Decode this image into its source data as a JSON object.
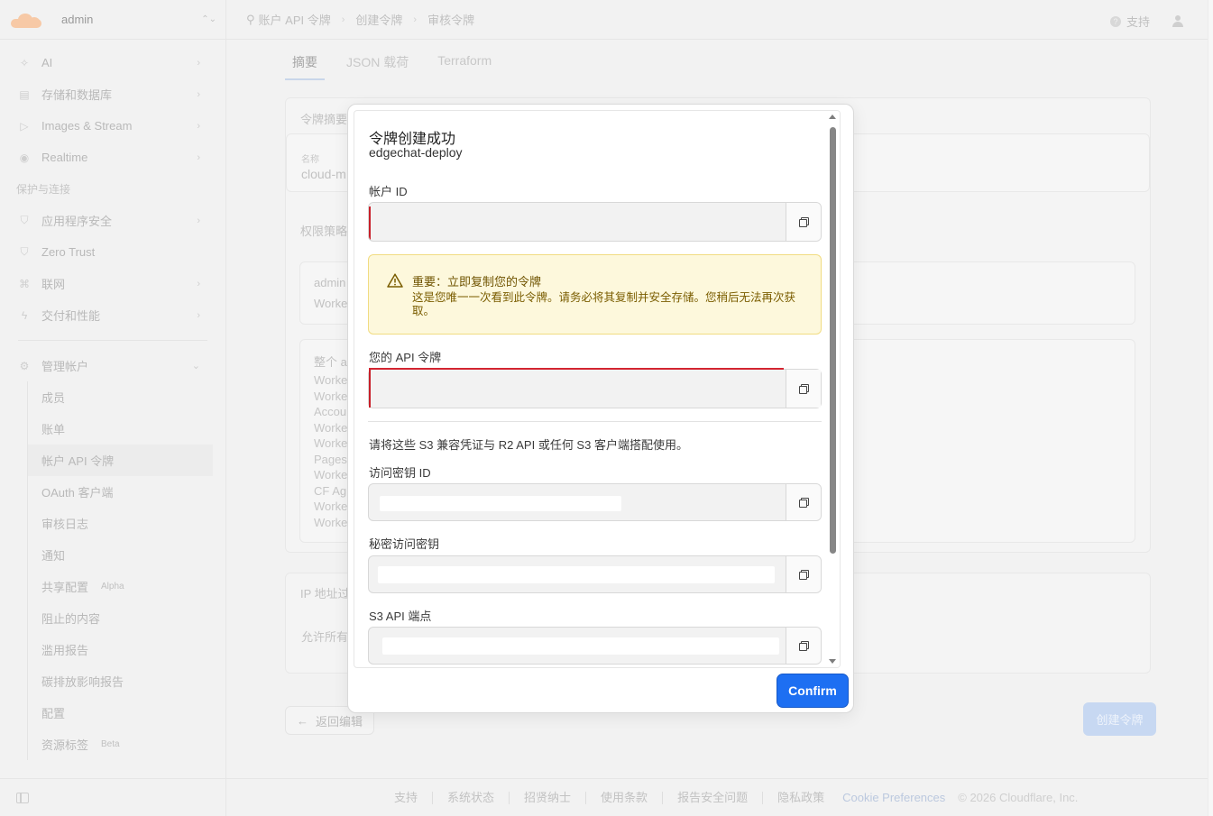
{
  "sidebar": {
    "account": "admin",
    "items": [
      {
        "label": "AI"
      },
      {
        "label": "存储和数据库"
      },
      {
        "label": "Images & Stream"
      },
      {
        "label": "Realtime"
      }
    ],
    "section": "保护与连接",
    "items2": [
      {
        "label": "应用程序安全"
      },
      {
        "label": "Zero Trust"
      },
      {
        "label": "联网"
      },
      {
        "label": "交付和性能"
      }
    ],
    "manage": "管理帐户",
    "sub_items": [
      {
        "label": "成员",
        "tag": ""
      },
      {
        "label": "账单",
        "tag": ""
      },
      {
        "label": "帐户 API 令牌",
        "tag": ""
      },
      {
        "label": "OAuth 客户端",
        "tag": ""
      },
      {
        "label": "审核日志",
        "tag": ""
      },
      {
        "label": "通知",
        "tag": ""
      },
      {
        "label": "共享配置",
        "tag": "Alpha"
      },
      {
        "label": "阻止的内容",
        "tag": ""
      },
      {
        "label": "滥用报告",
        "tag": ""
      },
      {
        "label": "碳排放影响报告",
        "tag": ""
      },
      {
        "label": "配置",
        "tag": ""
      },
      {
        "label": "资源标签",
        "tag": "Beta"
      }
    ]
  },
  "topbar": {
    "breadcrumb": [
      "账户 API 令牌",
      "创建令牌",
      "审核令牌"
    ],
    "support": "支持"
  },
  "main": {
    "tabs": [
      "摘要",
      "JSON 载荷",
      "Terraform"
    ],
    "summary_heading": "令牌摘要",
    "name_label": "名称",
    "name_value": "cloud-m",
    "policy_heading": "权限策略",
    "policy_title": "admin",
    "policy_sub": "Worke",
    "scope_title": "整个 a",
    "scope_list": [
      "Worke",
      "Worke",
      "Accou",
      "Worke",
      "Worke",
      "Pages",
      "Worke",
      "CF Ag",
      "Worke",
      "Worke"
    ],
    "ip_heading": "IP 地址过",
    "ip_value": "允许所有",
    "back_button": "返回编辑",
    "create_button": "创建令牌"
  },
  "footer": {
    "links": [
      "支持",
      "系统状态",
      "招贤纳士",
      "使用条款",
      "报告安全问题",
      "隐私政策"
    ],
    "cookie": "Cookie Preferences",
    "copyright": "© 2026 Cloudflare, Inc."
  },
  "modal": {
    "title": "令牌创建成功",
    "subtitle": "edgechat-deploy",
    "account_id_label": "帐户 ID",
    "warning_title": "重要：立即复制您的令牌",
    "warning_body": "这是您唯一一次看到此令牌。请务必将其复制并安全存储。您稍后无法再次获取。",
    "api_token_label": "您的 API 令牌",
    "s3_note": "请将这些 S3 兼容凭证与 R2 API 或任何 S3 客户端搭配使用。",
    "access_key_label": "访问密钥 ID",
    "secret_key_label": "秘密访问密钥",
    "s3_endpoint_label": "S3 API 端点",
    "confirm_button": "Confirm"
  },
  "colors": {
    "accent": "#1d6ff2",
    "warning_bg": "#fdf8dc",
    "warning_text": "#7a5d00",
    "redaction_mark": "#c8202a"
  },
  "icons": [
    "cloudflare-logo",
    "sparkle-icon",
    "database-icon",
    "play-icon",
    "broadcast-icon",
    "shield-icon",
    "network-icon",
    "bolt-icon",
    "gear-icon",
    "copy-icon",
    "warning-icon",
    "help-icon",
    "user-icon",
    "sidebar-toggle-icon"
  ]
}
